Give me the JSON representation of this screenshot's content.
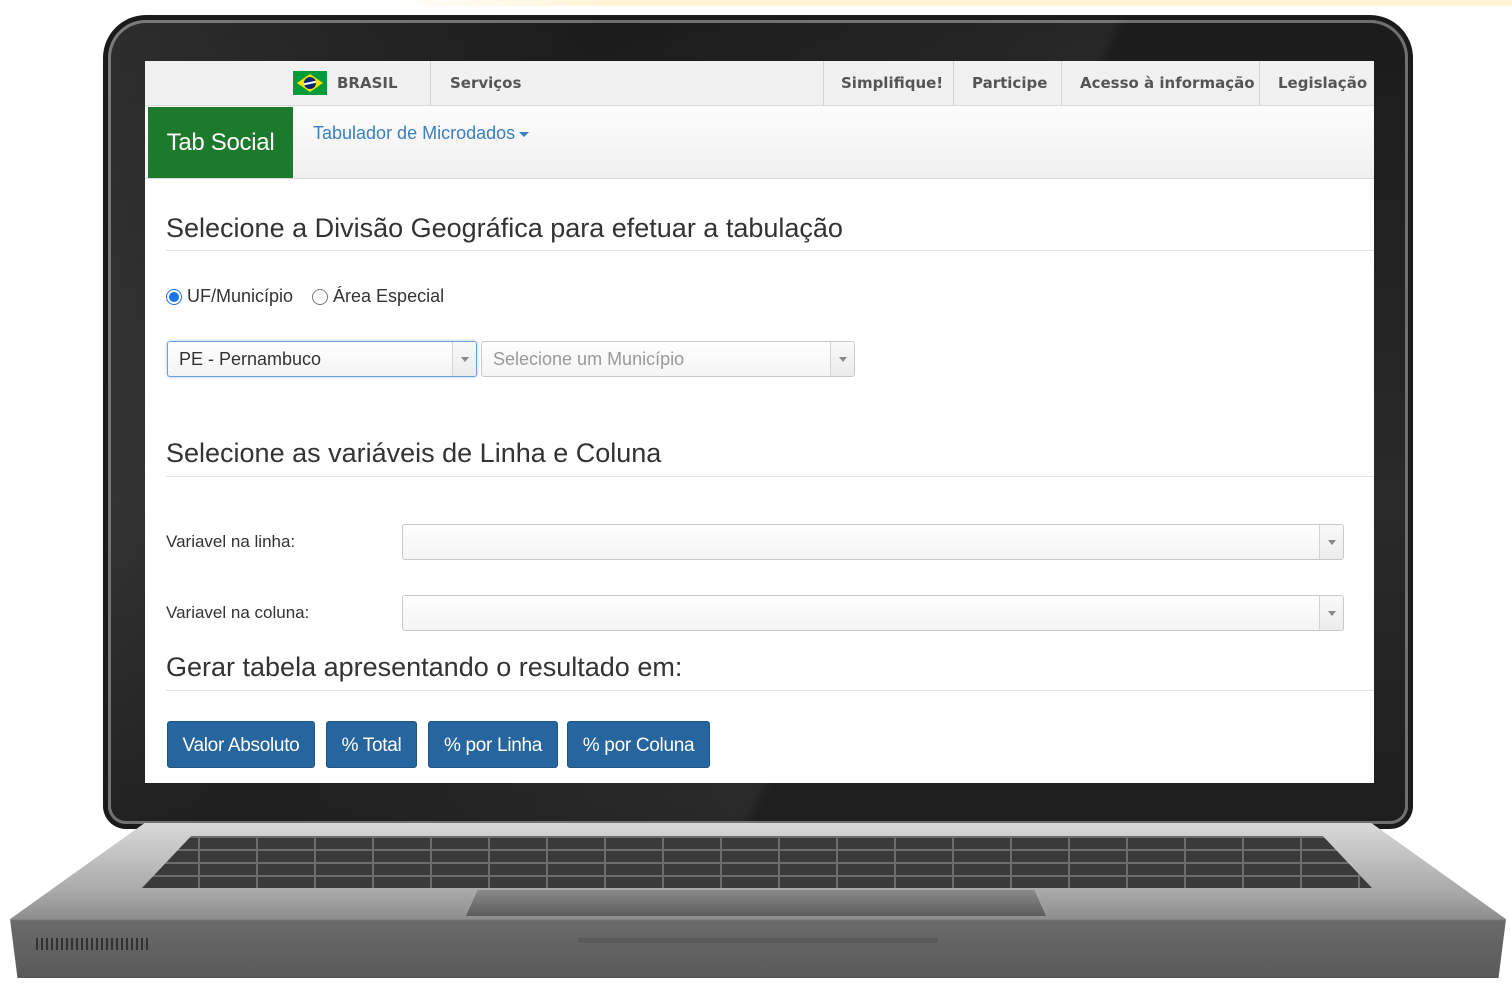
{
  "gov_bar": {
    "country": "BRASIL",
    "services": "Serviços",
    "links": [
      "Simplifique!",
      "Participe",
      "Acesso à informação",
      "Legislação"
    ]
  },
  "app": {
    "brand": "Tab Social",
    "menu": "Tabulador de Microdados"
  },
  "geo_section": {
    "title": "Selecione a Divisão Geográfica para efetuar a tabulação",
    "radio_uf": "UF/Município",
    "radio_area": "Área Especial",
    "selected_option": "UF/Município",
    "uf_select_value": "PE - Pernambuco",
    "municipio_placeholder": "Selecione um Município"
  },
  "vars_section": {
    "title": "Selecione as variáveis de Linha e Coluna",
    "row_label": "Variavel na linha:",
    "row_value": "",
    "col_label": "Variavel na coluna:",
    "col_value": ""
  },
  "result_section": {
    "title": "Gerar tabela apresentando o resultado em:",
    "buttons": [
      "Valor Absoluto",
      "% Total",
      "% por Linha",
      "% por Coluna"
    ]
  },
  "colors": {
    "brand_green": "#1d7a2c",
    "button_blue": "#27659f",
    "link_blue": "#3a7fc1"
  }
}
